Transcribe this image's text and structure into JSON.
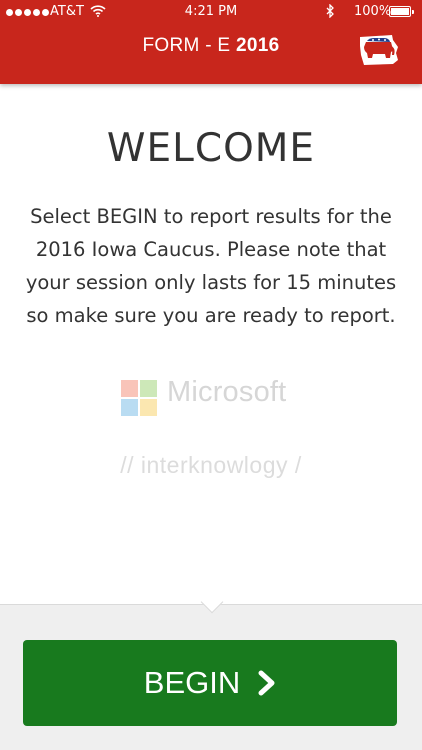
{
  "status_bar": {
    "carrier": "AT&T",
    "time": "4:21 PM",
    "battery": "100%"
  },
  "header": {
    "title_prefix": "FORM - E",
    "title_year": "2016",
    "badge_icon": "gop-iowa-elephant-icon"
  },
  "welcome": {
    "heading": "WELCOME",
    "message": "Select BEGIN to report results for the 2016 Iowa Caucus. Please note that your session only lasts for 15 minutes so make sure you are ready to report."
  },
  "sponsors": {
    "microsoft": "Microsoft",
    "interknowlogy": "// interknowlogy /"
  },
  "footer": {
    "begin_label": "BEGIN"
  },
  "colors": {
    "header_red": "#c8261c",
    "button_green": "#187a1e"
  }
}
